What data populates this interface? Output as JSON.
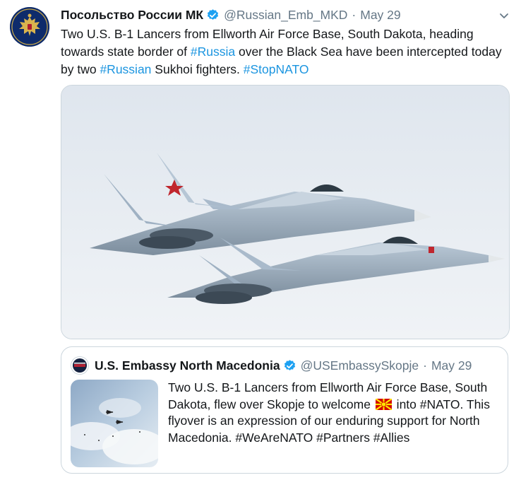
{
  "tweet": {
    "author_name": "Посольство России МК",
    "handle": "@Russian_Emb_MKD",
    "separator": "·",
    "date": "May 29",
    "text_parts": {
      "p1": "Two U.S. B-1 Lancers from Ellworth Air Force Base, South Dakota, heading towards state border of ",
      "h1": "#Russia",
      "p2": " over the Black Sea have been intercepted today by two ",
      "h2": "#Russian",
      "p3": " Sukhoi fighters. ",
      "h3": "#StopNATO"
    },
    "icons": {
      "avatar": "russian-coat-of-arms-icon",
      "verified": "verified-badge-icon",
      "menu": "chevron-down-icon"
    }
  },
  "quoted_tweet": {
    "author_name": "U.S. Embassy North Macedonia",
    "handle": "@USEmbassySkopje",
    "separator": "·",
    "date": "May 29",
    "text_parts": {
      "p1": "Two U.S. B-1 Lancers from Ellworth Air Force Base, South Dakota, flew over Skopje to welcome ",
      "p2": " into #NATO. This flyover is an expression of our enduring support for North Macedonia.  #WeAreNATO #Partners #Allies"
    },
    "icons": {
      "avatar": "us-embassy-seal-icon",
      "verified": "verified-badge-icon",
      "flag": "north-macedonia-flag-icon"
    }
  },
  "colors": {
    "text": "#14171a",
    "secondary": "#657786",
    "link": "#1b95e0",
    "border": "#ccd6dd",
    "verified": "#1da1f2"
  }
}
